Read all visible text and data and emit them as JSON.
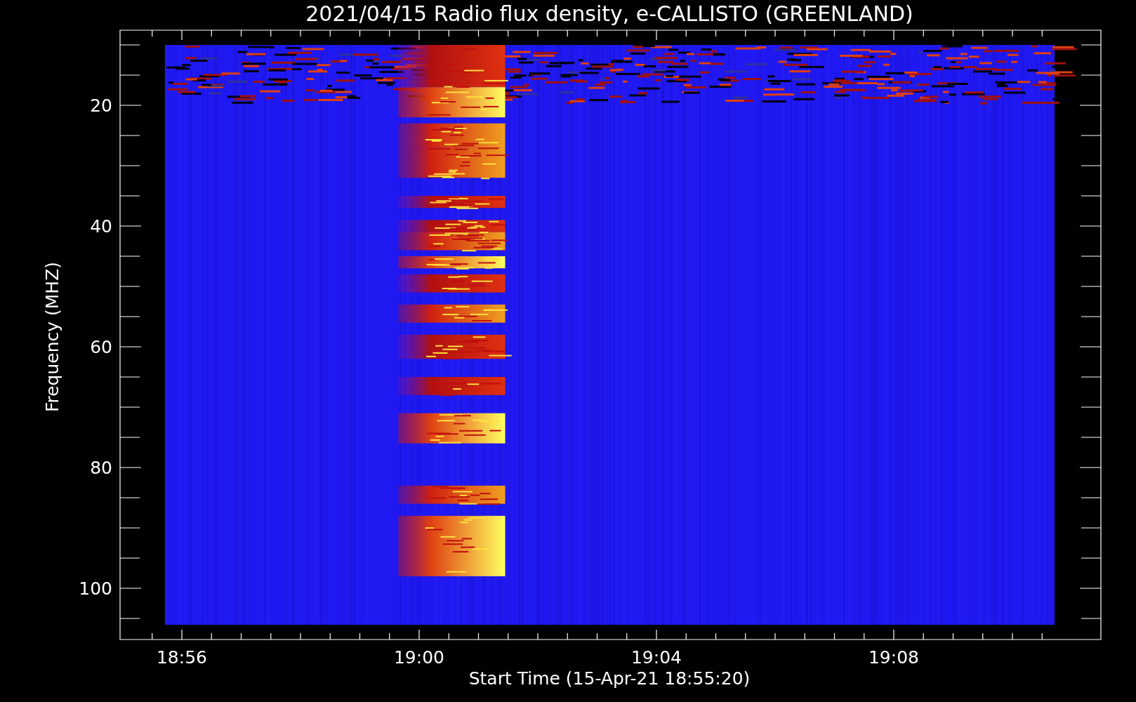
{
  "title": "2021/04/15  Radio flux density, e-CALLISTO (GREENLAND)",
  "y_axis": {
    "label": "Frequency (MHZ)",
    "ticks": [
      "20",
      "40",
      "60",
      "80",
      "100"
    ]
  },
  "x_axis": {
    "label": "Start Time (15-Apr-21 18:55:20)",
    "ticks": [
      "18:56",
      "19:00",
      "19:04",
      "19:08"
    ]
  }
}
